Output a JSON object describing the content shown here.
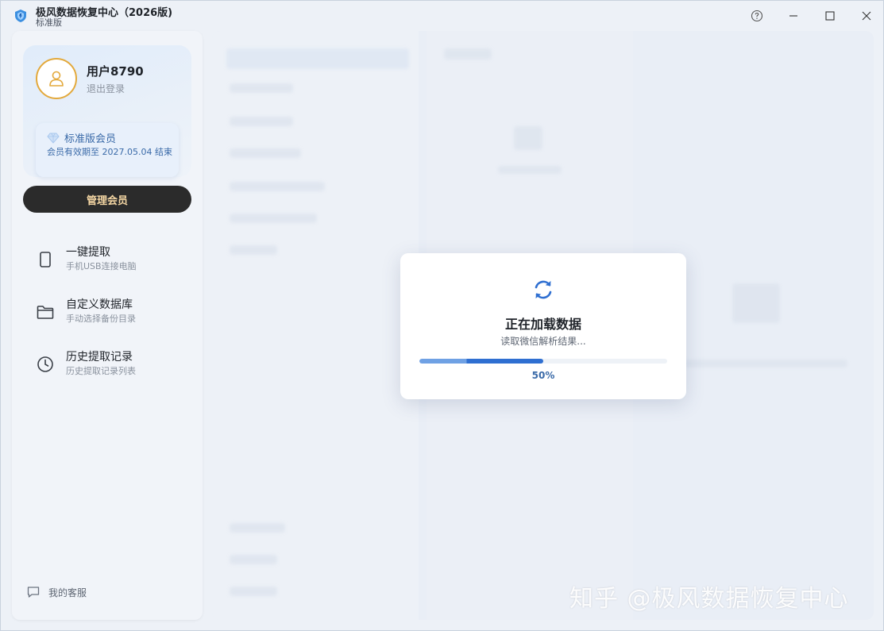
{
  "window": {
    "title": "极风数据恢复中心（2026版)",
    "subtitle": "标准版",
    "logo_icon": "shield-logo-icon",
    "controls": [
      "help-icon",
      "minimize-icon",
      "maximize-icon",
      "close-icon"
    ]
  },
  "profile": {
    "username": "用户8790",
    "logout": "退出登录",
    "membership": {
      "title": "标准版会员",
      "desc": "会员有效期至 2027.05.04 结束",
      "icon": "diamond-icon"
    },
    "manage_button": "管理会员"
  },
  "nav": {
    "items": [
      {
        "title": "一键提取",
        "sub": "手机USB连接电脑",
        "icon": "phone-icon"
      },
      {
        "title": "自定义数据库",
        "sub": "手动选择备份目录",
        "icon": "folder-icon"
      },
      {
        "title": "历史提取记录",
        "sub": "历史提取记录列表",
        "icon": "clock-icon"
      }
    ]
  },
  "support": {
    "label": "我的客服",
    "icon": "chat-icon"
  },
  "loading": {
    "title": "正在加载数据",
    "subtitle": "读取微信解析结果...",
    "progress": 0.5,
    "progress_label": "50%",
    "icon": "refresh-icon"
  },
  "watermark": "知乎 @极风数据恢复中心",
  "colors": {
    "accent": "#2f6fd1",
    "accent_light": "#6fa1e4",
    "avatar_ring": "#e3a93c",
    "manage_bg": "#2b2b2b",
    "manage_text": "#f5d7a4"
  }
}
